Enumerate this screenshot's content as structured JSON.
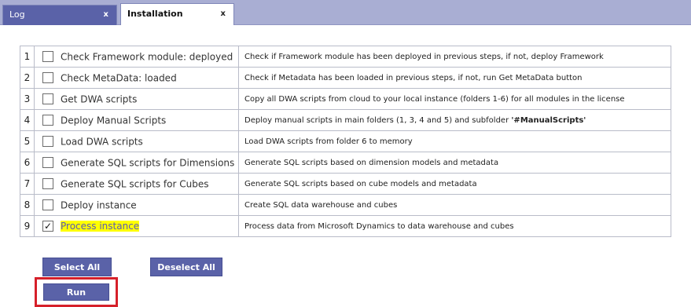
{
  "tabs": [
    {
      "label": "Log",
      "close": "x",
      "active": false
    },
    {
      "label": "Installation",
      "close": "x",
      "active": true
    }
  ],
  "steps": [
    {
      "num": "1",
      "checked": false,
      "label": "Check Framework module: deployed",
      "highlight": false,
      "desc": "Check if Framework module has been deployed in previous steps, if not, deploy Framework",
      "desc_bold": ""
    },
    {
      "num": "2",
      "checked": false,
      "label": "Check MetaData: loaded",
      "highlight": false,
      "desc": "Check if Metadata has been loaded in previous steps, if not, run Get MetaData button",
      "desc_bold": ""
    },
    {
      "num": "3",
      "checked": false,
      "label": "Get DWA scripts",
      "highlight": false,
      "desc": "Copy all DWA scripts from cloud to your local instance (folders 1-6) for all modules in the license",
      "desc_bold": ""
    },
    {
      "num": "4",
      "checked": false,
      "label": "Deploy Manual Scripts",
      "highlight": false,
      "desc": "Deploy manual scripts in main folders (1, 3, 4 and 5) and subfolder ",
      "desc_bold": "'#ManualScripts'"
    },
    {
      "num": "5",
      "checked": false,
      "label": "Load DWA scripts",
      "highlight": false,
      "desc": "Load DWA scripts from folder 6 to memory",
      "desc_bold": ""
    },
    {
      "num": "6",
      "checked": false,
      "label": "Generate SQL scripts for Dimensions",
      "highlight": false,
      "desc": "Generate SQL scripts based on dimension models and metadata",
      "desc_bold": ""
    },
    {
      "num": "7",
      "checked": false,
      "label": "Generate SQL scripts for Cubes",
      "highlight": false,
      "desc": "Generate SQL scripts based on cube models and metadata",
      "desc_bold": ""
    },
    {
      "num": "8",
      "checked": false,
      "label": "Deploy instance",
      "highlight": false,
      "desc": "Create SQL data warehouse and cubes",
      "desc_bold": ""
    },
    {
      "num": "9",
      "checked": true,
      "label": "Process instance",
      "highlight": true,
      "desc": "Process data from Microsoft Dynamics to data warehouse and cubes",
      "desc_bold": ""
    }
  ],
  "checkmark": "✓",
  "buttons": {
    "select_all": "Select All",
    "deselect_all": "Deselect All",
    "run": "Run"
  },
  "colors": {
    "tabbar": "#a9aed3",
    "button": "#5a62a8",
    "highlight": "#ffff00",
    "run_outline": "#d6202a"
  }
}
